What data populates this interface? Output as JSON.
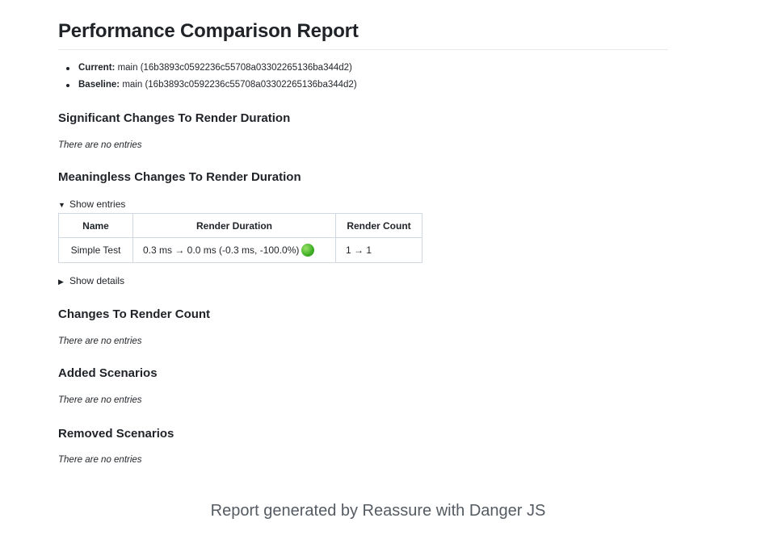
{
  "report": {
    "title": "Performance Comparison Report",
    "meta": [
      {
        "key": "Current:",
        "value": " main (16b3893c0592236c55708a03302265136ba344d2)"
      },
      {
        "key": "Baseline:",
        "value": " main (16b3893c0592236c55708a03302265136ba344d2)"
      }
    ],
    "sections": {
      "significant": {
        "title": "Significant Changes To Render Duration",
        "empty": "There are no entries"
      },
      "meaningless": {
        "title": "Meaningless Changes To Render Duration"
      },
      "render_count": {
        "title": "Changes To Render Count",
        "empty": "There are no entries"
      },
      "added": {
        "title": "Added Scenarios",
        "empty": "There are no entries"
      },
      "removed": {
        "title": "Removed Scenarios",
        "empty": "There are no entries"
      }
    },
    "show_entries": "Show entries",
    "show_details": "Show details",
    "table": {
      "headers": [
        "Name",
        "Render Duration",
        "Render Count"
      ],
      "rows": [
        {
          "name": "Simple Test",
          "duration": "0.3 ms → 0.0 ms (-0.3 ms, -100.0%)",
          "count": "1 → 1",
          "status_color": "#3dae24"
        }
      ]
    }
  },
  "footer": "Report generated by Reassure with Danger JS"
}
